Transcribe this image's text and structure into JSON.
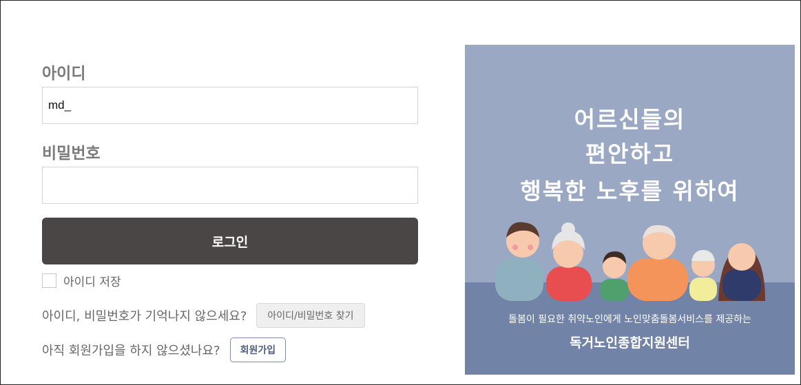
{
  "form": {
    "id_label": "아이디",
    "id_value": "md_",
    "password_label": "비밀번호",
    "password_value": "",
    "login_label": "로그인",
    "save_id_label": "아이디 저장",
    "forgot_text": "아이디, 비밀번호가 기억나지 않으세요?",
    "find_button": "아이디/비밀번호 찾기",
    "signup_text": "아직 회원가입을 하지 않으셨나요?",
    "signup_button": "회원가입"
  },
  "banner": {
    "headline_line1": "어르신들의",
    "headline_line2": "편안하고",
    "headline_line3": "행복한 노후를 위하여",
    "subtitle": "돌봄이 필요한 취약노인에게 노인맞춤돌봄서비스를 제공하는",
    "center_name": "독거노인종합지원센터",
    "illustration_icon": "family-group-illustration"
  },
  "colors": {
    "login_button": "#4a4645",
    "banner_bg": "#9aa8c4",
    "banner_floor": "#7283a8",
    "signup_border": "#7a8aa8"
  }
}
